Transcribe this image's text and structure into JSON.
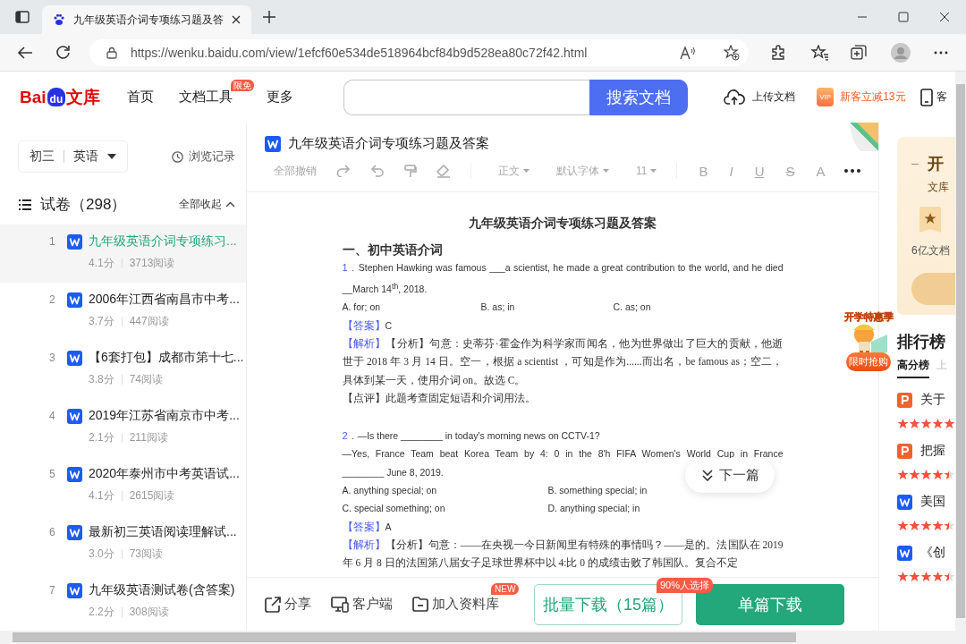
{
  "browser": {
    "tab_title": "九年级英语介词专项练习题及答",
    "url": "https://wenku.baidu.com/view/1efcf60e534de518964bcf84b9d528ea80c72f42.html"
  },
  "header": {
    "logo": [
      "Bai",
      "du",
      "文库"
    ],
    "nav": [
      {
        "label": "首页"
      },
      {
        "label": "文档工具",
        "badge": "限免"
      },
      {
        "label": "更多"
      }
    ],
    "search_button": "搜索文档",
    "upload": "上传文档",
    "vip_badge": "VIP",
    "promo": "新客立减13元",
    "app": "客"
  },
  "sidebar": {
    "grade": "初三",
    "subject": "英语",
    "history": "浏览记录",
    "list_title": "试卷（298）",
    "collapse": "全部收起",
    "items": [
      {
        "number": "1",
        "title": "九年级英语介词专项练习...",
        "score": "4.1分",
        "reads": "3713阅读",
        "selected": true
      },
      {
        "number": "2",
        "title": "2006年江西省南昌市中考...",
        "score": "3.7分",
        "reads": "447阅读",
        "selected": false
      },
      {
        "number": "3",
        "title": "【6套打包】成都市第十七...",
        "score": "3.8分",
        "reads": "74阅读",
        "selected": false
      },
      {
        "number": "4",
        "title": "2019年江苏省南京市中考...",
        "score": "2.1分",
        "reads": "211阅读",
        "selected": false
      },
      {
        "number": "5",
        "title": "2020年泰州市中考英语试...",
        "score": "4.1分",
        "reads": "2615阅读",
        "selected": false
      },
      {
        "number": "6",
        "title": "最新初三英语阅读理解试...",
        "score": "3.0分",
        "reads": "73阅读",
        "selected": false
      },
      {
        "number": "7",
        "title": "九年级英语测试卷(含答案)",
        "score": "2.2分",
        "reads": "308阅读",
        "selected": false
      }
    ]
  },
  "document": {
    "title": "九年级英语介词专项练习题及答案",
    "toolbar": {
      "disabled": true,
      "undo_all": "全部撤销",
      "style": "正文",
      "font": "默认字体",
      "size": "11",
      "formats": [
        "B",
        "I",
        "U",
        "S",
        "A"
      ]
    },
    "page": {
      "heading": "九年级英语介词专项练习题及答案",
      "section": "一、初中英语介词",
      "blocks": [
        {
          "kind": "question",
          "number": "1．",
          "text": "Stephen Hawking was famous ___a scientist, he made a great contribution to the world, and he died __March 14$^{th}$, 2018."
        },
        {
          "kind": "options",
          "options": [
            "A. for; on",
            "B. as; in",
            "C. as; on"
          ]
        },
        {
          "kind": "answer",
          "label": "【答案】",
          "text": "C"
        },
        {
          "kind": "analysis",
          "label": "【解析】",
          "text": "【分析】句意：史蒂芬·霍金作为科学家而闻名，他为世界做出了巨大的贡献，他逝世于 2018 年 3 月 14 日。空一，根据 a scientist ，可知是作为......而出名，be famous as；空二，具体到某一天，使用介词 on。故选 C。"
        },
        {
          "kind": "comment",
          "text": "【点评】此题考查固定短语和介词用法。"
        },
        {
          "kind": "question",
          "number": "2．",
          "text": "—Is there ________ in today's morning news on CCTV-1?"
        },
        {
          "kind": "line",
          "text": "—Yes, France Team beat Korea Team by 4: 0 in the 8'h FIFA Women's World Cup in France"
        },
        {
          "kind": "text",
          "text": "________ June 8, 2019."
        },
        {
          "kind": "options",
          "options": [
            "A. anything special; on",
            "B. something special; in",
            "C. special something; on",
            "D. anything special; in"
          ]
        },
        {
          "kind": "answer",
          "label": "【答案】",
          "text": "A"
        },
        {
          "kind": "analysis",
          "label": "【解析】",
          "text": "【分析】句意：——在央视一今日新闻里有特殊的事情吗？——是的。法国队在 2019 年 6 月 8 日的法国第八届女子足球世界杯中以 4:比 0 的成绩击败了韩国队。复合不定"
        }
      ]
    },
    "next": "下一篇"
  },
  "actions": {
    "share": "分享",
    "client": "客户端",
    "library": "加入资料库",
    "library_badge": "NEW",
    "batch": "批量下载（15篇）",
    "batch_badge": "90%人选择",
    "single": "单篇下载"
  },
  "right_panel": {
    "vip_card": {
      "title": "开",
      "subtitle": "文库",
      "feature": "6亿文档"
    },
    "sticker": {
      "title": "开学特惠季",
      "button": "限时抢购"
    },
    "ranking": {
      "title": "排行榜",
      "tabs": [
        {
          "label": "高分榜",
          "selected": true
        },
        {
          "label": "上",
          "selected": false
        }
      ],
      "items": [
        {
          "kind": "ppt",
          "title": "关于",
          "stars": 5
        },
        {
          "kind": "ppt",
          "title": "把握",
          "stars": 4.5
        },
        {
          "kind": "word",
          "title": "美国",
          "stars": 4.5
        },
        {
          "kind": "word",
          "title": "《创",
          "stars": 4.5
        }
      ]
    }
  }
}
